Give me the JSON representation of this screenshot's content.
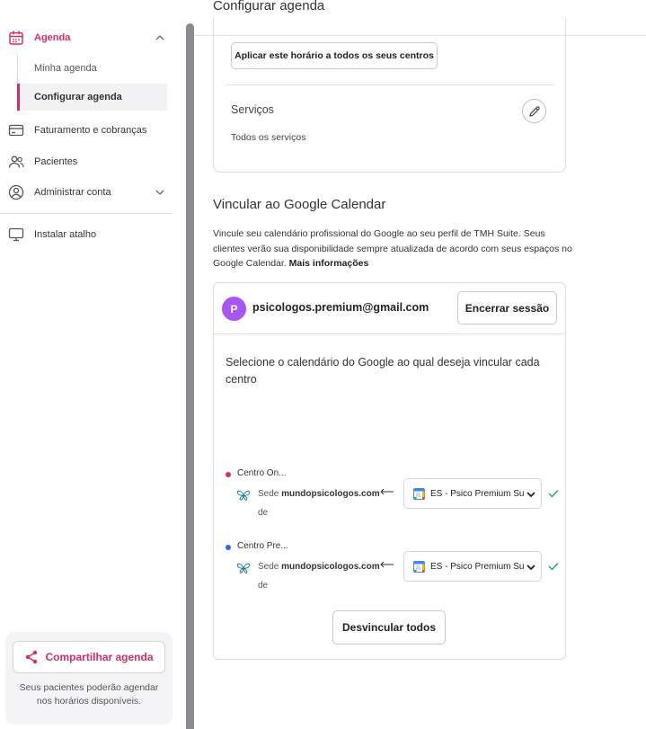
{
  "sidebar": {
    "agenda": "Agenda",
    "sub_items": [
      "Minha agenda",
      "Configurar agenda"
    ],
    "billing": "Faturamento e cobranças",
    "patients": "Pacientes",
    "account": "Administrar conta",
    "shortcut": "Instalar atalho",
    "share_button": "Compartilhar agenda",
    "share_note": "Seus pacientes poderão agendar nos horários disponíveis."
  },
  "main": {
    "page_title": "Configurar agenda",
    "apply_button": "Aplicar este horário a todos os seus centros",
    "services_title": "Serviços",
    "services_value": "Todos os serviços",
    "gc_title": "Vincular ao Google Calendar",
    "gc_desc": "Vincule seu calendário profissional do Google ao seu perfil de TMH Suite. Seus clientes verão sua disponibilidade sempre atualizada de acordo com seus espaços no Google Calendar.",
    "gc_more": "Mais informações",
    "avatar_letter": "P",
    "email": "psicologos.premium@gmail.com",
    "logout_button": "Encerrar sessão",
    "gc_prompt": "Selecione o calendário do Google ao qual deseja vincular cada centro",
    "centers": [
      {
        "name": "Centro On...",
        "dot_color": "#d92d62",
        "sede_prefix": "Sede",
        "sede_name": "mundopsicologos.com",
        "sede_suffix": "de",
        "calendar": "ES - Psico Premium Su"
      },
      {
        "name": "Centro Pre...",
        "dot_color": "#3366dd",
        "sede_prefix": "Sede",
        "sede_name": "mundopsicologos.com",
        "sede_suffix": "de",
        "calendar": "ES - Psico Premium Su"
      }
    ],
    "unlink_button": "Desvincular todos"
  },
  "colors": {
    "accent": "#d92d62",
    "avatar": "#a855f7",
    "success": "#2e9e6b"
  },
  "icons": [
    "calendar-icon",
    "chevron-up-icon",
    "credit-card-icon",
    "users-icon",
    "user-circle-icon",
    "chevron-down-icon",
    "monitor-icon",
    "share-icon",
    "pencil-icon",
    "butterfly-logo-icon",
    "arrow-left-icon",
    "google-calendar-icon",
    "check-icon"
  ]
}
